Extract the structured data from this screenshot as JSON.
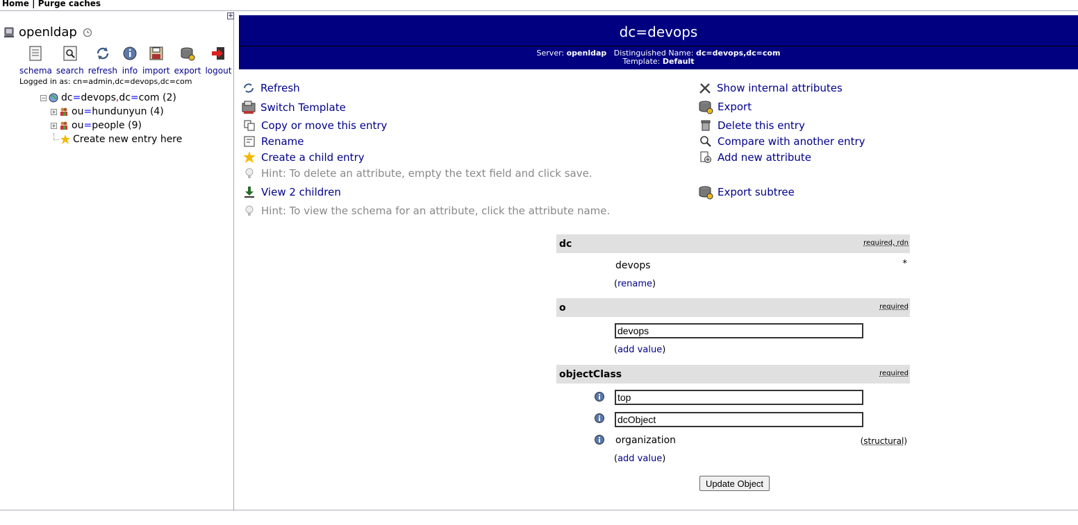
{
  "topnav": {
    "home": "Home",
    "separator": "|",
    "purge": "Purge caches"
  },
  "server": {
    "name": "openldap"
  },
  "toolbar": [
    {
      "label": "schema",
      "icon": "schema-icon"
    },
    {
      "label": "search",
      "icon": "search-icon"
    },
    {
      "label": "refresh",
      "icon": "refresh-icon"
    },
    {
      "label": "info",
      "icon": "info-icon"
    },
    {
      "label": "import",
      "icon": "import-icon"
    },
    {
      "label": "export",
      "icon": "export-icon"
    },
    {
      "label": "logout",
      "icon": "logout-icon"
    }
  ],
  "logged_in": "Logged in as: cn=admin,dc=devops,dc=com",
  "tree": {
    "root": {
      "k1": "dc",
      "v1": "devops",
      "k2": "dc",
      "v2": "com",
      "count": "(2)"
    },
    "children": [
      {
        "k": "ou",
        "v": "hundunyun",
        "count": "(4)"
      },
      {
        "k": "ou",
        "v": "people",
        "count": "(9)"
      }
    ],
    "create": "Create new entry here"
  },
  "banner": {
    "title": "dc=devops",
    "server_label": "Server:",
    "server_value": "openldap",
    "dn_label": "Distinguished Name:",
    "dn_value": "dc=devops,dc=com",
    "template_label": "Template:",
    "template_value": "Default"
  },
  "actions_left": {
    "refresh": "Refresh",
    "switch_template": "Switch Template",
    "copy_move": "Copy or move this entry",
    "rename": "Rename",
    "create_child": "Create a child entry",
    "hint_delete": "Hint: To delete an attribute, empty the text field and click save.",
    "view_children": "View 2 children",
    "hint_schema": "Hint: To view the schema for an attribute, click the attribute name."
  },
  "actions_right": {
    "show_internal": "Show internal attributes",
    "export": "Export",
    "delete": "Delete this entry",
    "compare": "Compare with another entry",
    "add_attr": "Add new attribute",
    "export_subtree": "Export subtree"
  },
  "attributes": {
    "dc": {
      "name": "dc",
      "req": "required",
      "req_sep": ",",
      "rdn": "rdn",
      "value": "devops",
      "marker": "*",
      "link_open": "(",
      "link": "rename",
      "link_close": ")"
    },
    "o": {
      "name": "o",
      "req": "required",
      "value": "devops",
      "link_open": "(",
      "link": "add value",
      "link_close": ")"
    },
    "objectClass": {
      "name": "objectClass",
      "req": "required",
      "values": [
        "top",
        "dcObject"
      ],
      "fixed_value": "organization",
      "structural_open": "(",
      "structural": "structural",
      "structural_close": ")",
      "link_open": "(",
      "link": "add value",
      "link_close": ")"
    }
  },
  "submit": "Update Object",
  "colors": {
    "banner": "#000080",
    "link": "#00008b",
    "attr_header": "#e0e0e0"
  }
}
